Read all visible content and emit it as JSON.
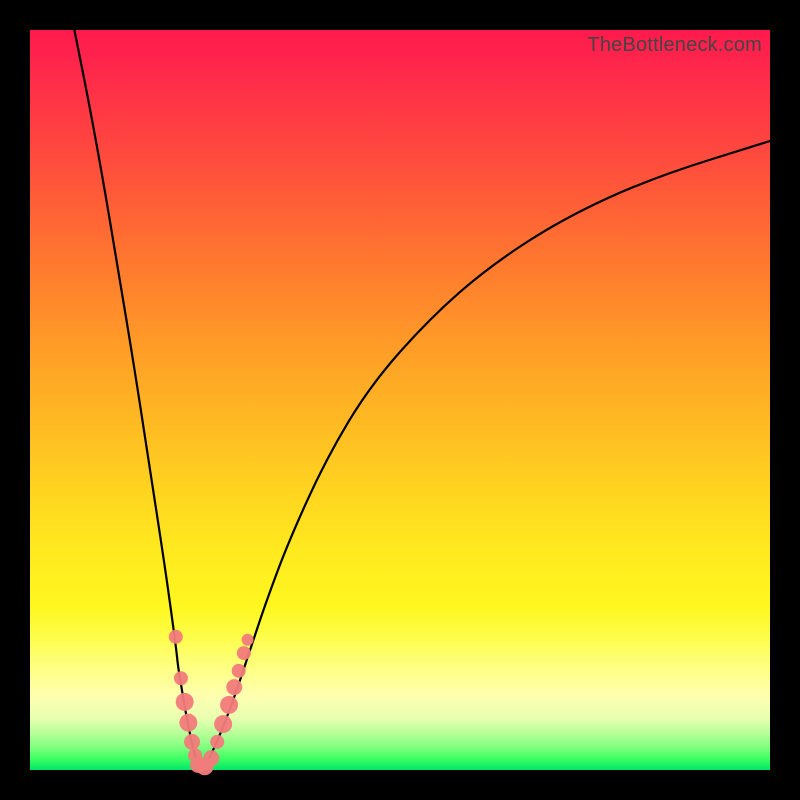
{
  "watermark": "TheBottleneck.com",
  "chart_data": {
    "type": "line",
    "title": "",
    "xlabel": "",
    "ylabel": "",
    "xlim": [
      0,
      100
    ],
    "ylim": [
      0,
      100
    ],
    "grid": false,
    "series": [
      {
        "name": "left-branch",
        "x": [
          6,
          8,
          10,
          12,
          14,
          16,
          18,
          19,
          19.8,
          20,
          20.5,
          21,
          21.5,
          22,
          22.5,
          23.2
        ],
        "y": [
          100,
          90,
          79,
          67,
          55,
          42,
          29,
          22,
          16,
          14,
          11,
          8,
          5.5,
          3,
          1.4,
          0
        ]
      },
      {
        "name": "right-branch",
        "x": [
          23.2,
          24,
          25,
          26,
          27,
          28,
          29,
          30,
          32,
          35,
          40,
          46,
          54,
          62,
          72,
          84,
          100
        ],
        "y": [
          0,
          1.2,
          3.2,
          5.6,
          8.2,
          11,
          14,
          17,
          23,
          31,
          42,
          52,
          61,
          68,
          74.5,
          80,
          85
        ]
      }
    ],
    "markers": [
      {
        "name": "left-dot-1",
        "x": 19.7,
        "y": 18,
        "r": 7
      },
      {
        "name": "left-dot-2",
        "x": 20.4,
        "y": 12.4,
        "r": 7
      },
      {
        "name": "left-dot-3",
        "x": 20.9,
        "y": 9.2,
        "r": 9
      },
      {
        "name": "left-dot-4",
        "x": 21.4,
        "y": 6.4,
        "r": 9
      },
      {
        "name": "left-dot-5",
        "x": 21.9,
        "y": 3.8,
        "r": 8
      },
      {
        "name": "left-dot-6",
        "x": 22.3,
        "y": 2.0,
        "r": 7
      },
      {
        "name": "bottom-dot-1",
        "x": 22.7,
        "y": 0.7,
        "r": 8
      },
      {
        "name": "bottom-dot-2",
        "x": 23.6,
        "y": 0.5,
        "r": 9
      },
      {
        "name": "bottom-dot-3",
        "x": 24.5,
        "y": 1.6,
        "r": 8
      },
      {
        "name": "right-dot-1",
        "x": 25.3,
        "y": 3.8,
        "r": 7
      },
      {
        "name": "right-dot-2",
        "x": 26.1,
        "y": 6.2,
        "r": 9
      },
      {
        "name": "right-dot-3",
        "x": 26.9,
        "y": 8.8,
        "r": 9
      },
      {
        "name": "right-dot-4",
        "x": 27.6,
        "y": 11.2,
        "r": 8
      },
      {
        "name": "right-dot-5",
        "x": 28.2,
        "y": 13.4,
        "r": 7
      },
      {
        "name": "right-dot-6",
        "x": 28.9,
        "y": 15.8,
        "r": 7
      },
      {
        "name": "right-dot-7",
        "x": 29.4,
        "y": 17.6,
        "r": 6
      }
    ],
    "marker_color": "#f27b7b",
    "curve_color": "#000000",
    "curve_width": 2.2
  }
}
